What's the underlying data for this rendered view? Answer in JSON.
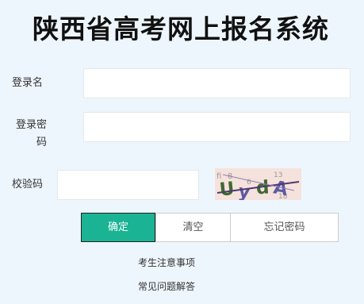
{
  "page": {
    "title": "陕西省高考网上报名系统"
  },
  "form": {
    "username_label": "登录名",
    "username_value": "",
    "password_label_line1": "登录密",
    "password_label_line2": "码",
    "password_value": "",
    "captcha_label": "校验码",
    "captcha_value": "",
    "captcha_image_text": "UydA",
    "captcha_noise_text": [
      "fi",
      "8",
      "13",
      "6",
      "18"
    ]
  },
  "buttons": {
    "confirm_label": "确定",
    "clear_label": "清空",
    "forgot_label": "忘记密码"
  },
  "links": {
    "notice_label": "考生注意事项",
    "faq_label": "常见问题解答"
  },
  "colors": {
    "background": "#eef6fd",
    "accent": "#1ab394",
    "captcha_background": "#f6e2dc",
    "captcha_text": "#3d6a2f",
    "captcha_text_alt": "#5d5aa3"
  }
}
